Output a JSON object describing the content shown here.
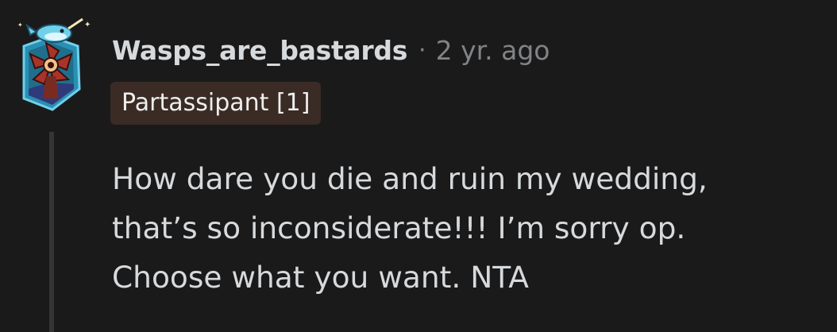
{
  "comment": {
    "username": "Wasps_are_bastards",
    "separator": "·",
    "timestamp": "2 yr. ago",
    "flair": "Partassipant [1]",
    "body_lines": [
      "How dare you die and ruin my wedding,",
      "that’s so inconsiderate!!! I’m sorry op.",
      "Choose what you want. NTA"
    ],
    "avatar_icon": "narwhal-demogorgon-avatar-icon"
  },
  "colors": {
    "background": "#1a1a1b",
    "username": "#d7dadc",
    "meta": "#818384",
    "flair_background": "#3a2b25",
    "flair_text": "#eeeeee",
    "body_text": "#d7dadc",
    "thread_line": "#343536"
  }
}
